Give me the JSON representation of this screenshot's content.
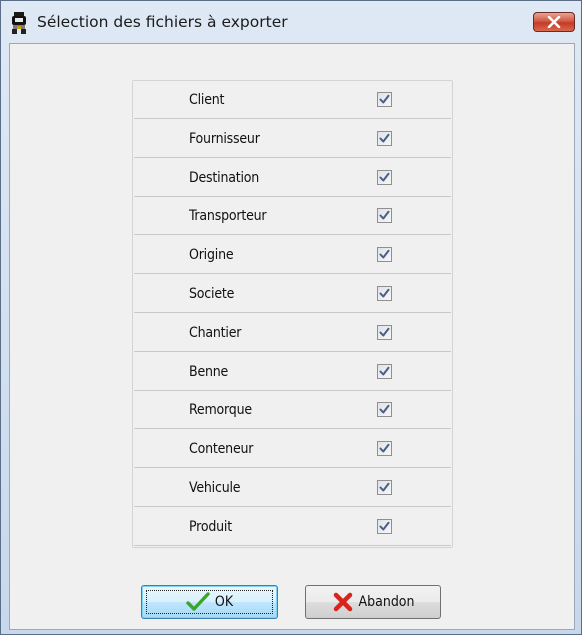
{
  "window": {
    "title": "Sélection des fichiers à exporter"
  },
  "files": [
    {
      "label": "Client",
      "checked": true
    },
    {
      "label": "Fournisseur",
      "checked": true
    },
    {
      "label": "Destination",
      "checked": true
    },
    {
      "label": "Transporteur",
      "checked": true
    },
    {
      "label": "Origine",
      "checked": true
    },
    {
      "label": "Societe",
      "checked": true
    },
    {
      "label": "Chantier",
      "checked": true
    },
    {
      "label": "Benne",
      "checked": true
    },
    {
      "label": "Remorque",
      "checked": true
    },
    {
      "label": "Conteneur",
      "checked": true
    },
    {
      "label": "Vehicule",
      "checked": true
    },
    {
      "label": "Produit",
      "checked": true
    }
  ],
  "buttons": {
    "ok_label": "OK",
    "abandon_label": "Abandon"
  },
  "icons": {
    "app": "app-icon",
    "close": "close-icon",
    "ok": "checkmark-icon",
    "abandon": "cross-icon"
  },
  "colors": {
    "check_green": "#3aa629",
    "cross_red": "#d9241b",
    "checkbox_mark": "#4a5f86"
  }
}
